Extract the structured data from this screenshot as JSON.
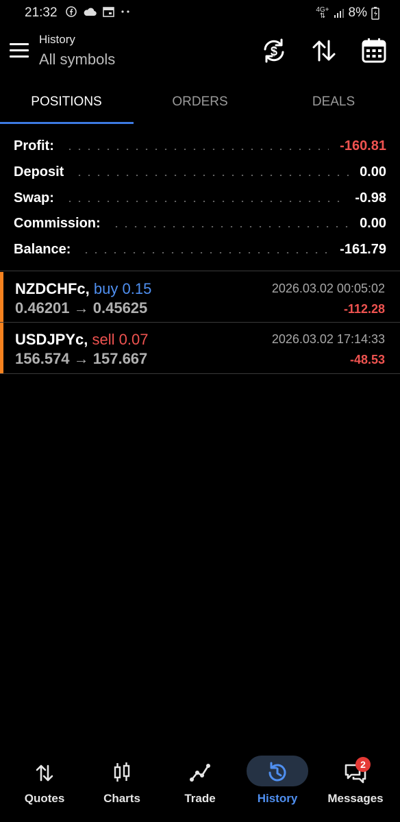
{
  "status_bar": {
    "time": "21:32",
    "network": "4G+",
    "battery": "8%",
    "icons": [
      "facebook-icon",
      "cloud-icon",
      "calendar-icon",
      "more-dots-icon",
      "signal-icon",
      "battery-icon"
    ]
  },
  "header": {
    "title": "History",
    "subtitle": "All symbols",
    "actions": [
      "currency-refresh-icon",
      "sort-icon",
      "calendar-icon"
    ]
  },
  "tabs": [
    {
      "label": "POSITIONS",
      "active": true
    },
    {
      "label": "ORDERS",
      "active": false
    },
    {
      "label": "DEALS",
      "active": false
    }
  ],
  "summary": [
    {
      "label": "Profit:",
      "value": "-160.81",
      "negative": true
    },
    {
      "label": "Deposit",
      "value": "0.00",
      "negative": false
    },
    {
      "label": "Swap:",
      "value": "-0.98",
      "negative": false
    },
    {
      "label": "Commission:",
      "value": "0.00",
      "negative": false
    },
    {
      "label": "Balance:",
      "value": "-161.79",
      "negative": false
    }
  ],
  "positions": [
    {
      "symbol": "NZDCHFc,",
      "side": "buy 0.15",
      "prices": "0.46201 → 0.45625",
      "time": "2026.03.02 00:05:02",
      "profit": "-112.28"
    },
    {
      "symbol": "USDJPYc,",
      "side": "sell 0.07",
      "prices": "156.574 → 157.667",
      "time": "2026.03.02 17:14:33",
      "profit": "-48.53"
    }
  ],
  "bottom_nav": [
    {
      "label": "Quotes",
      "icon": "quotes-icon",
      "active": false
    },
    {
      "label": "Charts",
      "icon": "charts-icon",
      "active": false
    },
    {
      "label": "Trade",
      "icon": "trade-icon",
      "active": false
    },
    {
      "label": "History",
      "icon": "history-icon",
      "active": true
    },
    {
      "label": "Messages",
      "icon": "messages-icon",
      "active": false,
      "badge": "2"
    }
  ],
  "colors": {
    "accent": "#3d7ae2",
    "negative": "#ef5350",
    "position_accent": "#f5821f",
    "background": "#000000"
  }
}
